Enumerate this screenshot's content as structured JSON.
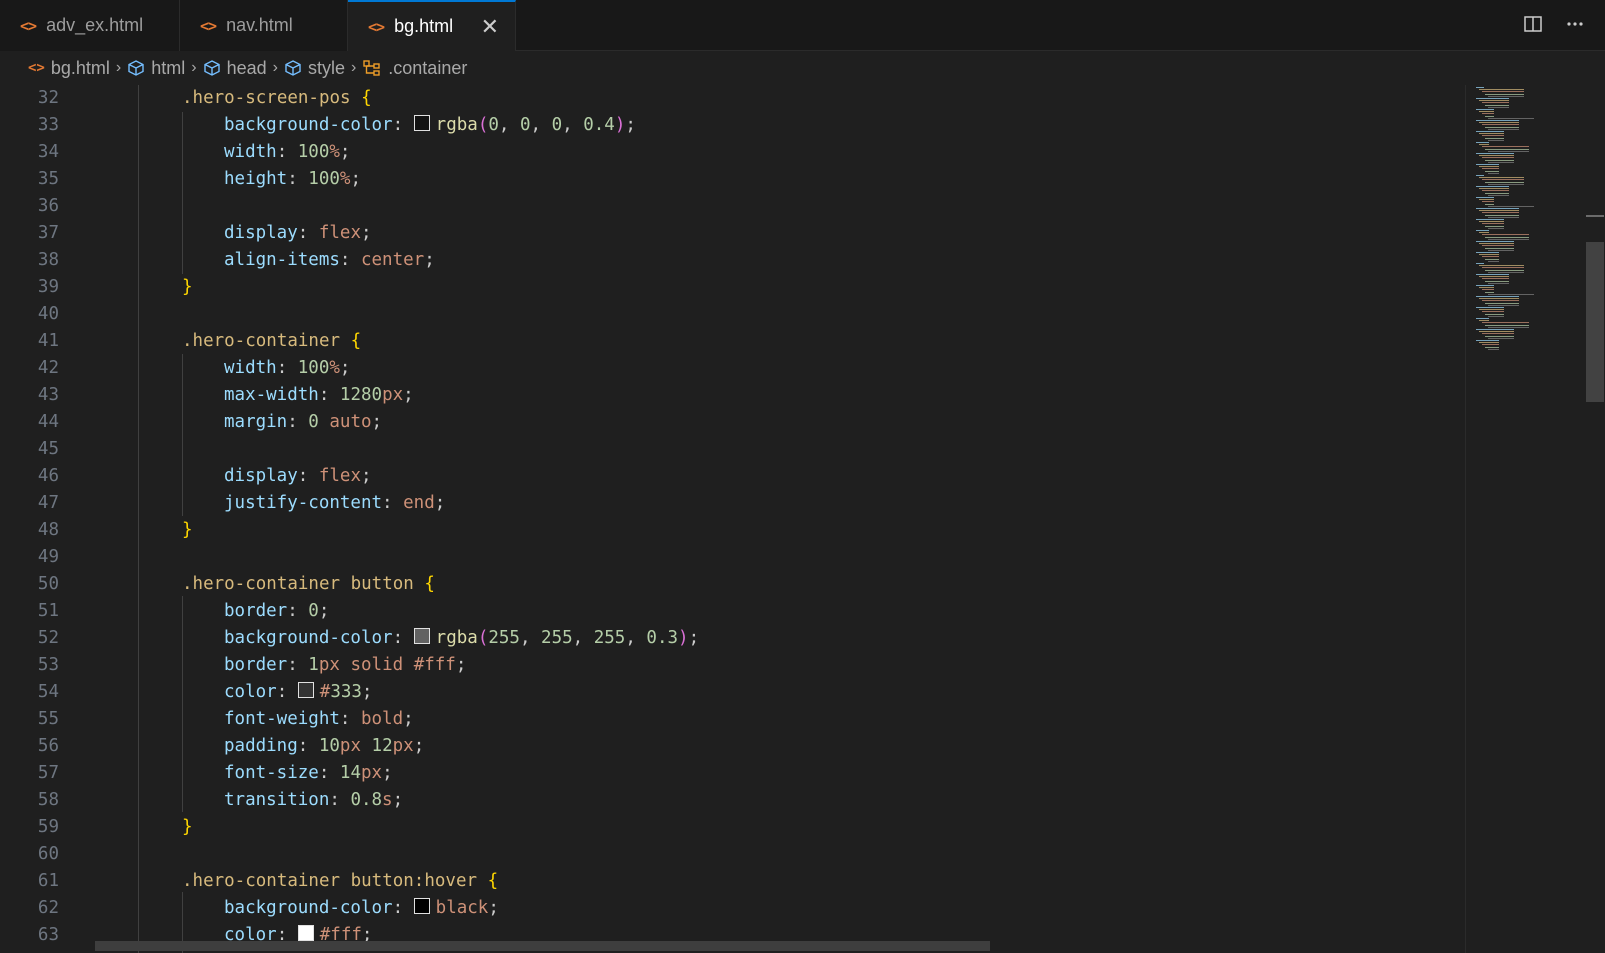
{
  "tabs": [
    {
      "label": "adv_ex.html",
      "icon": "html-file-icon",
      "active": false
    },
    {
      "label": "nav.html",
      "icon": "html-file-icon",
      "active": false
    },
    {
      "label": "bg.html",
      "icon": "html-file-icon",
      "active": true
    }
  ],
  "tab_actions": {
    "split": "split-editor-icon",
    "more": "more-actions-icon"
  },
  "breadcrumb": [
    {
      "label": "bg.html",
      "icon": "html-file-icon"
    },
    {
      "label": "html",
      "icon": "symbol-element-icon"
    },
    {
      "label": "head",
      "icon": "symbol-element-icon"
    },
    {
      "label": "style",
      "icon": "symbol-element-icon"
    },
    {
      "label": ".container",
      "icon": "symbol-class-icon"
    }
  ],
  "colors": {
    "accent": "#0078d4",
    "tab_icon": "#e37933",
    "selector": "#d7ba7d",
    "property": "#9cdcfe",
    "value": "#ce9178",
    "number": "#b5cea8"
  },
  "code": {
    "first_line": 32,
    "lines": [
      ".hero-screen-pos {",
      "    background-color: rgba(0, 0, 0, 0.4);",
      "    width: 100%;",
      "    height: 100%;",
      "",
      "    display: flex;",
      "    align-items: center;",
      "}",
      "",
      ".hero-container {",
      "    width: 100%;",
      "    max-width: 1280px;",
      "    margin: 0 auto;",
      "",
      "    display: flex;",
      "    justify-content: end;",
      "}",
      "",
      ".hero-container button {",
      "    border: 0;",
      "    background-color: rgba(255, 255, 255, 0.3);",
      "    border: 1px solid #fff;",
      "    color: #333;",
      "    font-weight: bold;",
      "    padding: 10px 12px;",
      "    font-size: 14px;",
      "    transition: 0.8s;",
      "}",
      "",
      ".hero-container button:hover {",
      "    background-color: black;",
      "    color: #fff;"
    ]
  }
}
